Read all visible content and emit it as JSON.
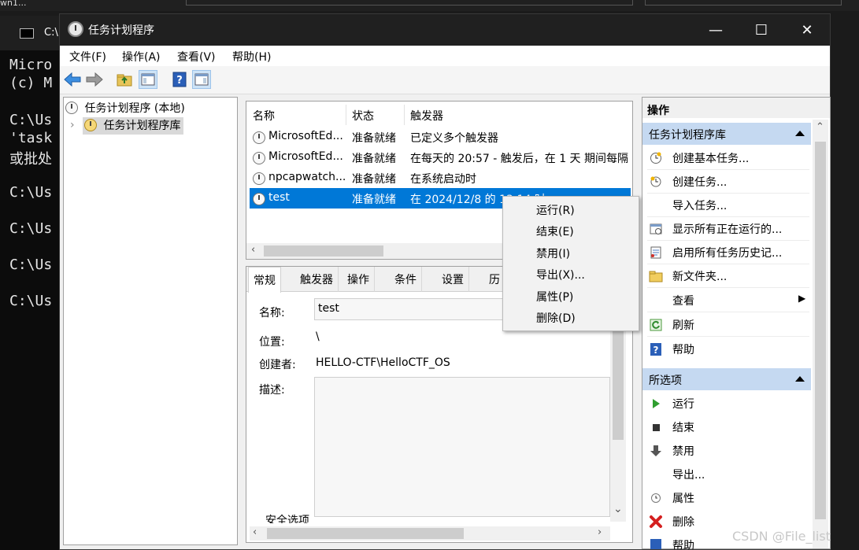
{
  "background": {
    "top_text": "wn1...",
    "terminal": {
      "tab_title": "C:\\",
      "lines": [
        "Micro",
        "(c) M",
        "C:\\Us",
        "'task",
        "或批处",
        "C:\\Us",
        "C:\\Us",
        "C:\\Us",
        "C:\\Us"
      ]
    }
  },
  "window": {
    "title": "任务计划程序",
    "controls": {
      "minimize": "—",
      "maximize": "☐",
      "close": "✕"
    }
  },
  "menu": [
    "文件(F)",
    "操作(A)",
    "查看(V)",
    "帮助(H)"
  ],
  "toolbar": {
    "icons": [
      "back-arrow-icon",
      "forward-arrow-icon",
      "folder-up-icon",
      "show-pane-icon",
      "help-icon",
      "show-action-pane-icon"
    ]
  },
  "tree": {
    "root": "任务计划程序 (本地)",
    "child": "任务计划程序库",
    "expander": "›"
  },
  "task_list": {
    "columns": [
      "名称",
      "状态",
      "触发器"
    ],
    "rows": [
      {
        "name": "MicrosoftEd...",
        "status": "准备就绪",
        "trigger": "已定义多个触发器",
        "selected": false
      },
      {
        "name": "MicrosoftEd...",
        "status": "准备就绪",
        "trigger": "在每天的 20:57 - 触发后，在 1 天 期间每隔",
        "selected": false
      },
      {
        "name": "npcapwatch...",
        "status": "准备就绪",
        "trigger": "在系统启动时",
        "selected": false
      },
      {
        "name": "test",
        "status": "准备就绪",
        "trigger": "在 2024/12/8 的 13:14 时",
        "selected": true
      }
    ],
    "scroll_left": "‹"
  },
  "detail": {
    "tabs": [
      "常规",
      "触发器",
      "操作",
      "条件",
      "设置",
      "历"
    ],
    "fields": {
      "name_label": "名称:",
      "name_value": "test",
      "location_label": "位置:",
      "location_value": "\\",
      "author_label": "创建者:",
      "author_value": "HELLO-CTF\\HelloCTF_OS",
      "desc_label": "描述:",
      "security_label": "安全选项"
    },
    "scroll_down": "⌄",
    "scroll_left": "‹",
    "scroll_right": "›"
  },
  "context_menu": [
    "运行(R)",
    "结束(E)",
    "禁用(I)",
    "导出(X)...",
    "属性(P)",
    "删除(D)"
  ],
  "actions_pane": {
    "title": "操作",
    "section1": {
      "title": "任务计划程序库",
      "items": [
        {
          "label": "创建基本任务...",
          "icon": "create-basic-task-icon"
        },
        {
          "label": "创建任务...",
          "icon": "create-task-icon"
        },
        {
          "label": "导入任务...",
          "icon": ""
        },
        {
          "label": "显示所有正在运行的...",
          "icon": "running-tasks-icon"
        },
        {
          "label": "启用所有任务历史记...",
          "icon": "history-icon"
        },
        {
          "label": "新文件夹...",
          "icon": "new-folder-icon"
        },
        {
          "label": "查看",
          "icon": "",
          "submenu": "▶"
        },
        {
          "label": "刷新",
          "icon": "refresh-icon"
        },
        {
          "label": "帮助",
          "icon": "help-icon"
        }
      ]
    },
    "section2": {
      "title": "所选项",
      "items": [
        {
          "label": "运行",
          "icon": "run-icon"
        },
        {
          "label": "结束",
          "icon": "end-icon"
        },
        {
          "label": "禁用",
          "icon": "disable-icon"
        },
        {
          "label": "导出...",
          "icon": ""
        },
        {
          "label": "属性",
          "icon": "properties-icon"
        },
        {
          "label": "删除",
          "icon": "delete-icon"
        },
        {
          "label": "帮助",
          "icon": "help-icon"
        }
      ]
    },
    "scroll_up": "⌃"
  },
  "watermark": "CSDN @File_list",
  "colors": {
    "selection": "#0078d7",
    "section_header": "#c5d9f1",
    "titlebar": "#202020"
  }
}
